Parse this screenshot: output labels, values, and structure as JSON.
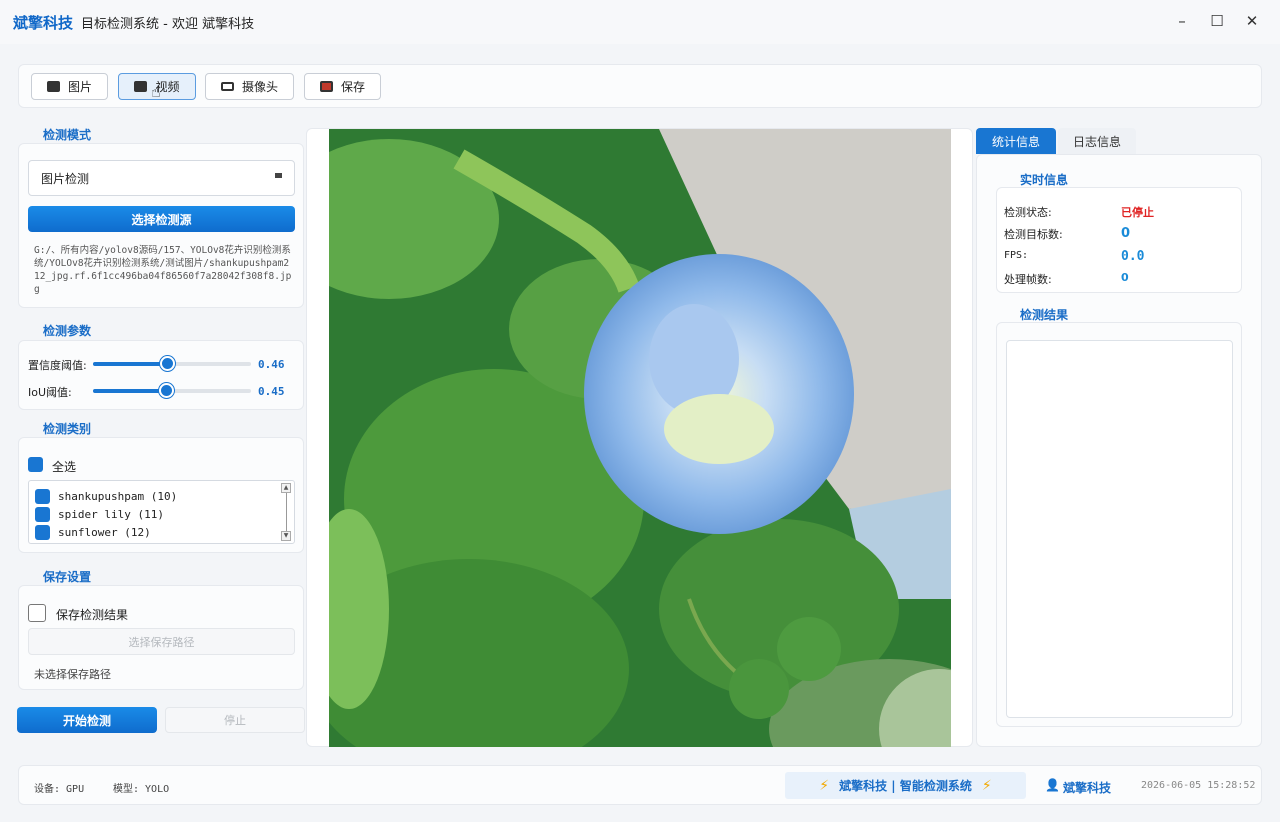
{
  "window": {
    "brand": "斌擎科技",
    "title": "目标检测系统 - 欢迎 斌擎科技",
    "controls": {
      "minimize": "–",
      "maximize": "☐",
      "close": "✕"
    }
  },
  "toolbar": {
    "buttons": [
      {
        "label": "图片",
        "icon": "image-icon"
      },
      {
        "label": "视频",
        "icon": "video-icon"
      },
      {
        "label": "摄像头",
        "icon": "camera-icon"
      },
      {
        "label": "保存",
        "icon": "save-icon"
      }
    ]
  },
  "detect_mode": {
    "title": "检测模式",
    "selected_mode": "图片检测",
    "select_source_label": "选择检测源",
    "source_path": "G:/、所有内容/yolov8源码/157、YOLOv8花卉识别检测系统/YOLOv8花卉识别检测系统/测试图片/shankupushpam212_jpg.rf.6f1cc496ba04f86560f7a28042f308f8.jpg"
  },
  "detect_params": {
    "title": "检测参数",
    "confidence": {
      "label": "置信度阈值:",
      "value": 0.46,
      "display": "0.46"
    },
    "iou": {
      "label": "IoU阈值:",
      "value": 0.45,
      "display": "0.45"
    }
  },
  "detect_classes": {
    "title": "检测类别",
    "select_all_label": "全选",
    "items": [
      "shankupushpam (10)",
      "spider lily (11)",
      "sunflower (12)"
    ]
  },
  "save_settings": {
    "title": "保存设置",
    "save_results_label": "保存检测结果",
    "choose_path_label": "选择保存路径",
    "path_status": "未选择保存路径"
  },
  "actions": {
    "start_label": "开始检测",
    "stop_label": "停止"
  },
  "right_tabs": {
    "stats_label": "统计信息",
    "log_label": "日志信息"
  },
  "realtime": {
    "title": "实时信息",
    "rows": [
      {
        "label": "检测状态:",
        "value": "已停止"
      },
      {
        "label": "检测目标数:",
        "value": "0"
      },
      {
        "label": "FPS:",
        "value": "0.0"
      },
      {
        "label": "处理帧数:",
        "value": "0"
      }
    ]
  },
  "results": {
    "title": "检测结果"
  },
  "statusbar": {
    "device": "设备: GPU",
    "model": "模型: YOLO",
    "banner": "斌擎科技 | 智能检测系统",
    "user": "斌擎科技",
    "timestamp": "2026-06-05 15:28:52"
  },
  "colors": {
    "accent": "#1976d2",
    "stopped": "#e02424",
    "title_blue": "#1a6dc7"
  }
}
